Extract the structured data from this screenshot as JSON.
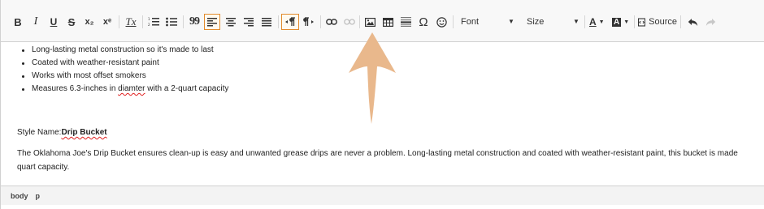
{
  "toolbar": {
    "bold": "B",
    "italic": "I",
    "underline": "U",
    "strike": "S",
    "subscript": "x₂",
    "superscript": "xᵉ",
    "remove_format": "Tx",
    "quote": "99",
    "omega": "Ω",
    "font_label": "Font",
    "size_label": "Size",
    "text_color": "A",
    "bg_color": "A",
    "source_label": "Source"
  },
  "content": {
    "bullets": [
      "Long-lasting metal construction so it's made to last",
      "Coated with weather-resistant paint",
      "Works with most offset smokers"
    ],
    "bullet4_before": "Measures 6.3-inches in ",
    "bullet4_misspelled": "diamter",
    "bullet4_after": " with a 2-quart capacity",
    "style_label": "Style Name:",
    "style_value": "Drip Bucket",
    "description": "The Oklahoma Joe's Drip Bucket ensures clean-up is easy and unwanted grease drips are never a problem. Long-lasting metal construction and coated with weather-resistant paint, this bucket is made",
    "description_cont": "quart capacity."
  },
  "statusbar": {
    "path": [
      "body",
      "p"
    ]
  },
  "colors": {
    "active_border": "#e28b2c",
    "arrow": "#e9b88c",
    "spell_error": "#e02020"
  }
}
